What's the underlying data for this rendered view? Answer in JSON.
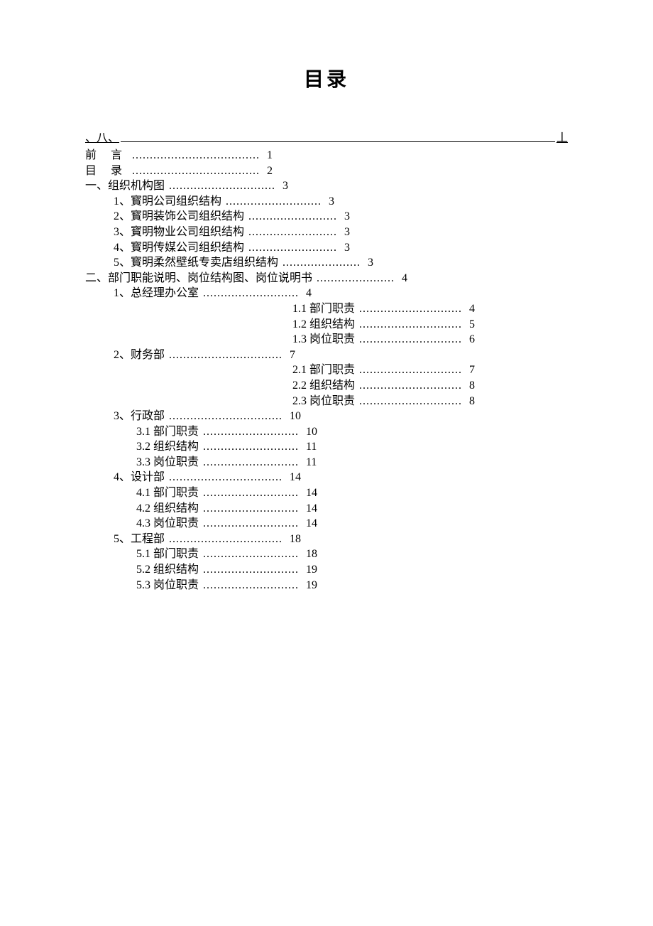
{
  "title": "目录",
  "rule": {
    "left": "、八、",
    "right": "丄"
  },
  "entries": [
    {
      "indent": 0,
      "label": "前 言",
      "page": "1",
      "w": "w-short",
      "spaced": true
    },
    {
      "indent": 0,
      "label": "目 录",
      "page": "2",
      "w": "w-short",
      "spaced": true
    },
    {
      "indent": 0,
      "label": "一、组织机构图",
      "page": "3",
      "w": "w-med2"
    },
    {
      "indent": 1,
      "label": "1、寳明公司组织结构",
      "page": "3",
      "w": "w-long"
    },
    {
      "indent": 1,
      "label": "2、寳明装饰公司组织结构",
      "page": "3",
      "w": "w-sub"
    },
    {
      "indent": 1,
      "label": "3、寳明物业公司组织结构",
      "page": "3",
      "w": "w-sub"
    },
    {
      "indent": 1,
      "label": "4、寳明传媒公司组织结构",
      "page": "3",
      "w": "w-sub"
    },
    {
      "indent": 1,
      "label": "5、寳明柔然壁纸专卖店组织结构",
      "page": "3",
      "w": "w-sub2"
    },
    {
      "indent": 0,
      "label": "二、部门职能说明、岗位结构图、岗位说明书",
      "page": "4",
      "w": "w-sub2"
    },
    {
      "indent": 1,
      "label": "1、总经理办公室",
      "page": "4",
      "w": "w-long"
    },
    {
      "indent": 3,
      "label": "1.1 部门职责",
      "page": "4",
      "w": "w-deep"
    },
    {
      "indent": 3,
      "label": "1.2 组织结构",
      "page": "5",
      "w": "w-deep"
    },
    {
      "indent": 3,
      "label": "1.3 岗位职责",
      "page": "6",
      "w": "w-deep"
    },
    {
      "indent": 1,
      "label": "2、财务部",
      "page": "7",
      "w": "w-med"
    },
    {
      "indent": 3,
      "label": "2.1 部门职责",
      "page": "7",
      "w": "w-deep"
    },
    {
      "indent": 3,
      "label": "2.2 组织结构",
      "page": "8",
      "w": "w-deep"
    },
    {
      "indent": 3,
      "label": "2.3 岗位职责",
      "page": "8",
      "w": "w-deep"
    },
    {
      "indent": 1,
      "label": "3、行政部",
      "page": "10",
      "w": "w-med"
    },
    {
      "indent": 2,
      "label": "3.1 部门职责",
      "page": "10",
      "w": "w-long"
    },
    {
      "indent": 2,
      "label": "3.2 组织结构",
      "page": "11",
      "w": "w-long"
    },
    {
      "indent": 2,
      "label": "3.3 岗位职责",
      "page": "11",
      "w": "w-long"
    },
    {
      "indent": 1,
      "label": "4、设计部",
      "page": "14",
      "w": "w-med"
    },
    {
      "indent": 2,
      "label": "4.1 部门职责",
      "page": "14",
      "w": "w-long"
    },
    {
      "indent": 2,
      "label": "4.2 组织结构",
      "page": "14",
      "w": "w-long"
    },
    {
      "indent": 2,
      "label": "4.3 岗位职责",
      "page": "14",
      "w": "w-long"
    },
    {
      "indent": 1,
      "label": "5、工程部",
      "page": "18",
      "w": "w-med"
    },
    {
      "indent": 2,
      "label": "5.1 部门职责",
      "page": "18",
      "w": "w-long"
    },
    {
      "indent": 2,
      "label": "5.2 组织结构",
      "page": "19",
      "w": "w-long"
    },
    {
      "indent": 2,
      "label": "5.3 岗位职责",
      "page": "19",
      "w": "w-long"
    }
  ]
}
